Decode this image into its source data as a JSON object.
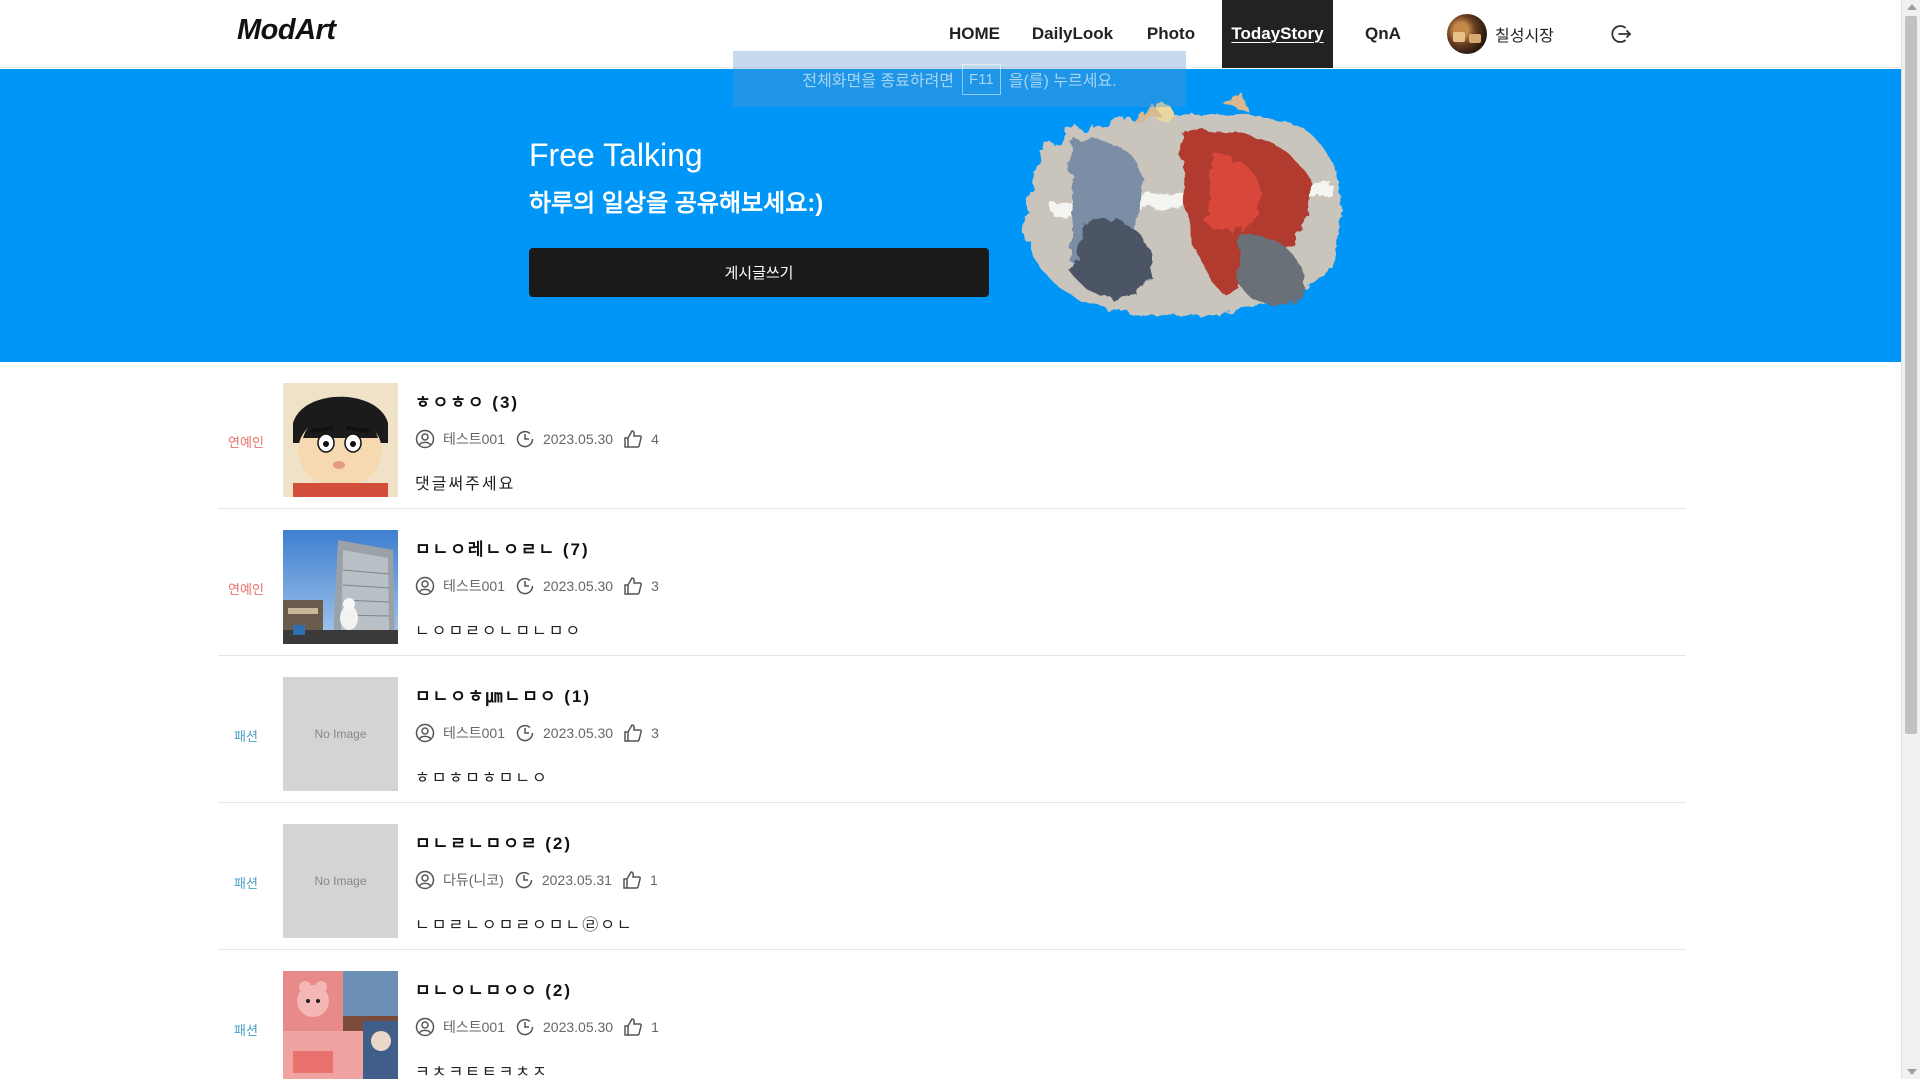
{
  "header": {
    "logo": "ModArt",
    "nav": [
      {
        "label": "HOME",
        "active": false
      },
      {
        "label": "DailyLook",
        "active": false
      },
      {
        "label": "Photo",
        "active": false
      },
      {
        "label": "TodayStory",
        "active": true
      },
      {
        "label": "QnA",
        "active": false
      }
    ],
    "profile_name": "칠성시장",
    "logout_icon": "logout-icon"
  },
  "toast": {
    "before": "전체화면을 종료하려면",
    "key": "F11",
    "after": "을(를) 누르세요."
  },
  "hero": {
    "title": "Free Talking",
    "subtitle": "하루의 일상을 공유해보세요:)",
    "button": "게시글쓰기",
    "background_color": "#0096f7",
    "art": "volleyball-painting"
  },
  "posts": [
    {
      "category": "연예인",
      "category_color": "#e8726a",
      "title": "ㅎㅇㅎㅇ",
      "comments": "(3)",
      "author": "테스트001",
      "date": "2023.05.30",
      "likes": "4",
      "body": "댓글써주세요",
      "thumb": "cartoon-face"
    },
    {
      "category": "연예인",
      "category_color": "#e8726a",
      "title": "ㅁㄴㅇ레ㄴㅇㄹㄴ",
      "comments": "(7)",
      "author": "테스트001",
      "date": "2023.05.30",
      "likes": "3",
      "body": "ㄴㅇㅁㄹㅇㄴㅁㄴㅁㅇ",
      "thumb": "building-photo"
    },
    {
      "category": "패션",
      "category_color": "#4a9fc4",
      "title": "ㅁㄴㅇㅎ㎛ㄴㅁㅇ",
      "comments": "(1)",
      "author": "테스트001",
      "date": "2023.05.30",
      "likes": "3",
      "body": "ㅎㅁㅎㅁㅎㅁㄴㅇ",
      "thumb": "none",
      "no_image": "No Image"
    },
    {
      "category": "패션",
      "category_color": "#4a9fc4",
      "title": "ㅁㄴㄹㄴㅁㅇㄹ",
      "comments": "(2)",
      "author": "다듀(니코)",
      "date": "2023.05.31",
      "likes": "1",
      "body": "ㄴㅁㄹㄴㅇㅁㄹㅇㅁㄴ㉣ㅇㄴ",
      "thumb": "none",
      "no_image": "No Image"
    },
    {
      "category": "패션",
      "category_color": "#4a9fc4",
      "title": "ㅁㄴㅇㄴㅁㅇㅇ",
      "comments": "(2)",
      "author": "테스트001",
      "date": "2023.05.30",
      "likes": "1",
      "body": "ㅋㅊㅋㅌㅌㅋㅊㅈ",
      "thumb": "pink-toys-photo"
    }
  ]
}
